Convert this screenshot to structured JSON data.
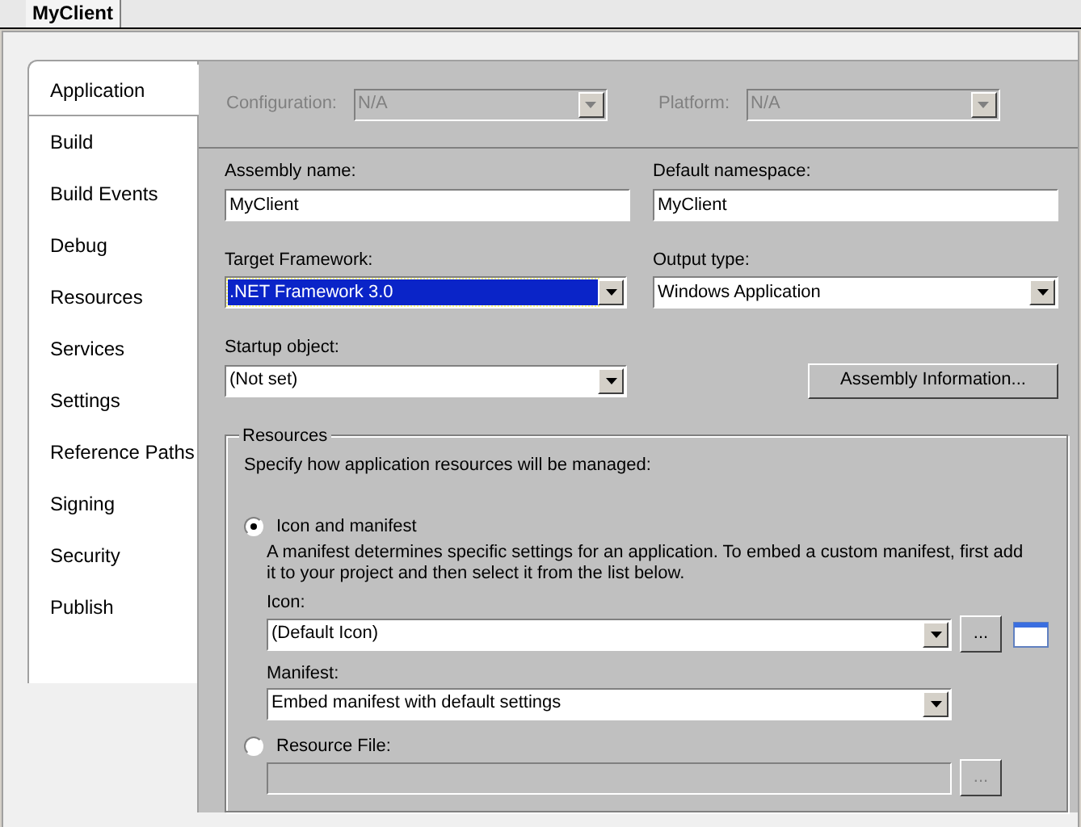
{
  "document_tab": {
    "label": "MyClient"
  },
  "nav": [
    {
      "label": "Application",
      "selected": true
    },
    {
      "label": "Build",
      "selected": false
    },
    {
      "label": "Build Events",
      "selected": false
    },
    {
      "label": "Debug",
      "selected": false
    },
    {
      "label": "Resources",
      "selected": false
    },
    {
      "label": "Services",
      "selected": false
    },
    {
      "label": "Settings",
      "selected": false
    },
    {
      "label": "Reference Paths",
      "selected": false
    },
    {
      "label": "Signing",
      "selected": false
    },
    {
      "label": "Security",
      "selected": false
    },
    {
      "label": "Publish",
      "selected": false
    }
  ],
  "configuration": {
    "label": "Configuration:",
    "value": "N/A",
    "disabled": true
  },
  "platform": {
    "label": "Platform:",
    "value": "N/A",
    "disabled": true
  },
  "assembly_name": {
    "label": "Assembly name:",
    "value": "MyClient"
  },
  "default_namespace": {
    "label": "Default namespace:",
    "value": "MyClient"
  },
  "target_framework": {
    "label": "Target Framework:",
    "value": ".NET Framework 3.0",
    "focused": true
  },
  "output_type": {
    "label": "Output type:",
    "value": "Windows Application",
    "focused": false
  },
  "startup_object": {
    "label": "Startup object:",
    "value": "(Not set)",
    "focused": false
  },
  "assembly_info_button": "Assembly Information...",
  "resources": {
    "title": "Resources",
    "description": "Specify how application resources will be managed:",
    "icon_and_manifest": {
      "label": "Icon and manifest",
      "selected": true,
      "description": "A manifest determines specific settings for an application. To embed a custom manifest, first add it to your project and then select it from the list below.",
      "icon": {
        "label": "Icon:",
        "value": "(Default Icon)",
        "browse": "..."
      },
      "manifest": {
        "label": "Manifest:",
        "value": "Embed manifest with default settings"
      }
    },
    "resource_file": {
      "label": "Resource File:",
      "selected": false,
      "field_disabled": true,
      "browse": "..."
    }
  }
}
